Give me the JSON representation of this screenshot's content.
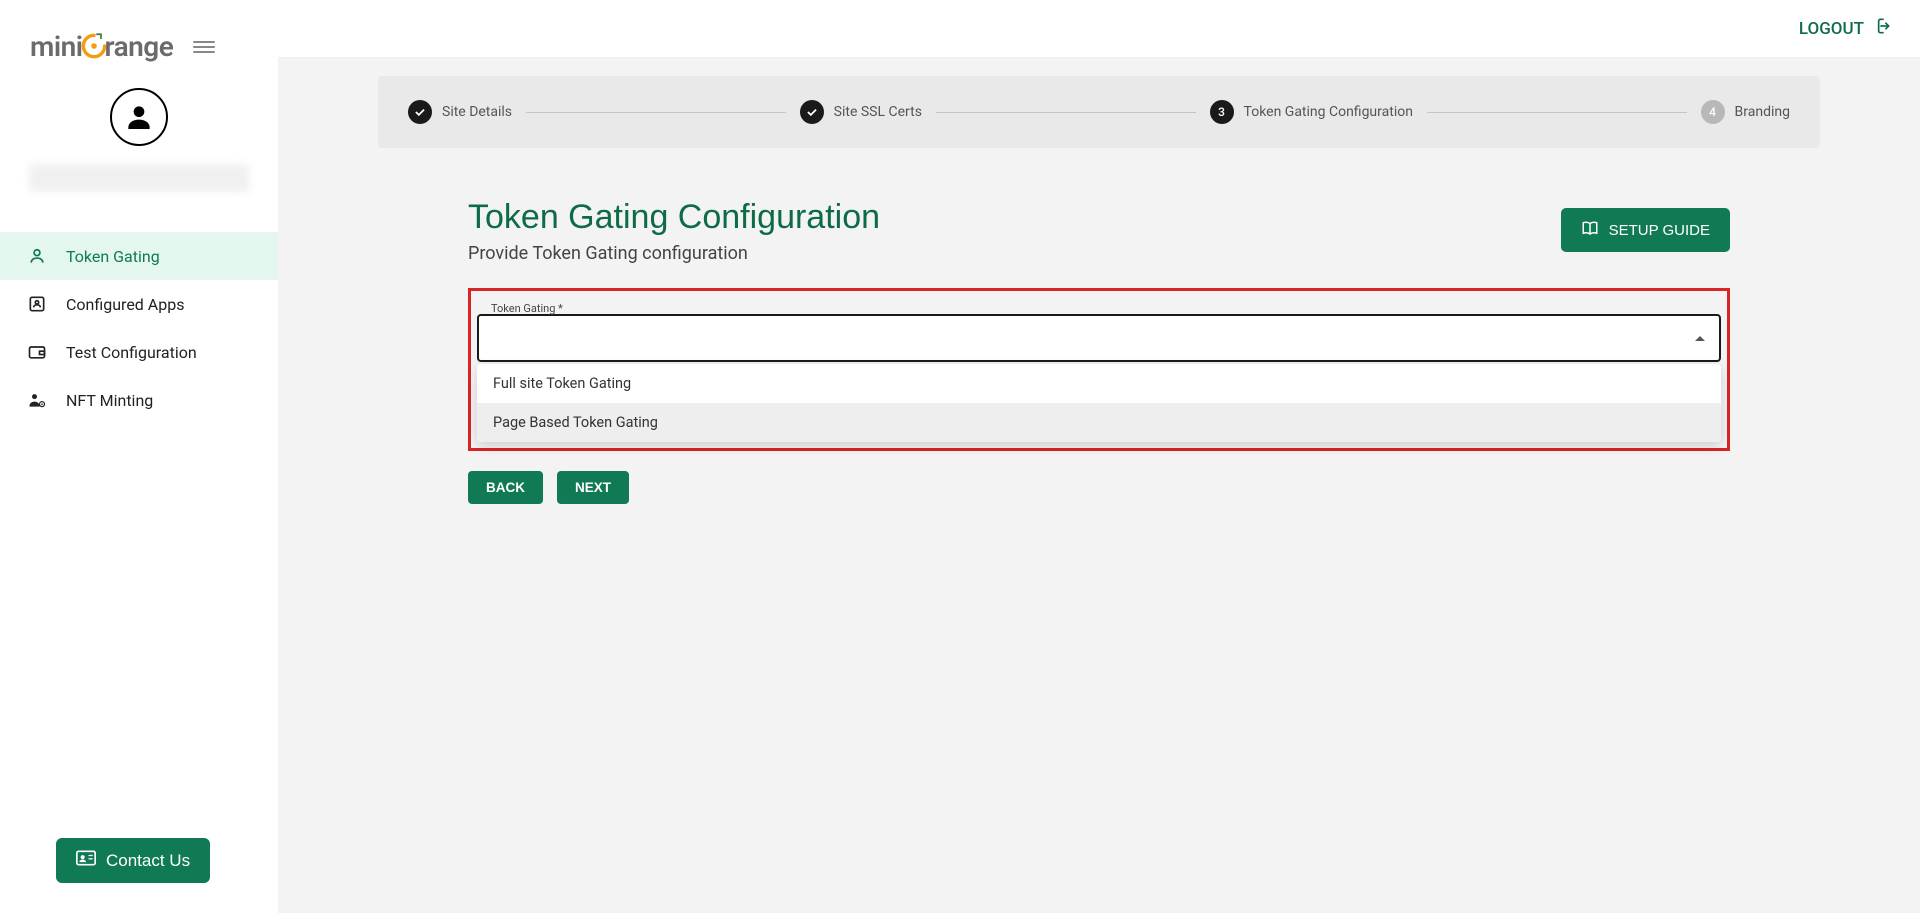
{
  "brand": {
    "mini": "mini",
    "range": "range"
  },
  "header": {
    "logout": "LOGOUT"
  },
  "sidebar": {
    "items": [
      {
        "label": "Token Gating"
      },
      {
        "label": "Configured Apps"
      },
      {
        "label": "Test Configuration"
      },
      {
        "label": "NFT Minting"
      }
    ],
    "contact": "Contact Us"
  },
  "stepper": {
    "steps": [
      {
        "label": "Site Details"
      },
      {
        "label": "Site SSL Certs"
      },
      {
        "num": "3",
        "label": "Token Gating Configuration"
      },
      {
        "num": "4",
        "label": "Branding"
      }
    ]
  },
  "page": {
    "title": "Token Gating Configuration",
    "subtitle": "Provide Token Gating configuration",
    "setup_guide": "SETUP GUIDE",
    "select_label": "Token Gating *",
    "options": [
      "Full site Token Gating",
      "Page Based Token Gating"
    ],
    "back": "BACK",
    "next": "NEXT"
  }
}
